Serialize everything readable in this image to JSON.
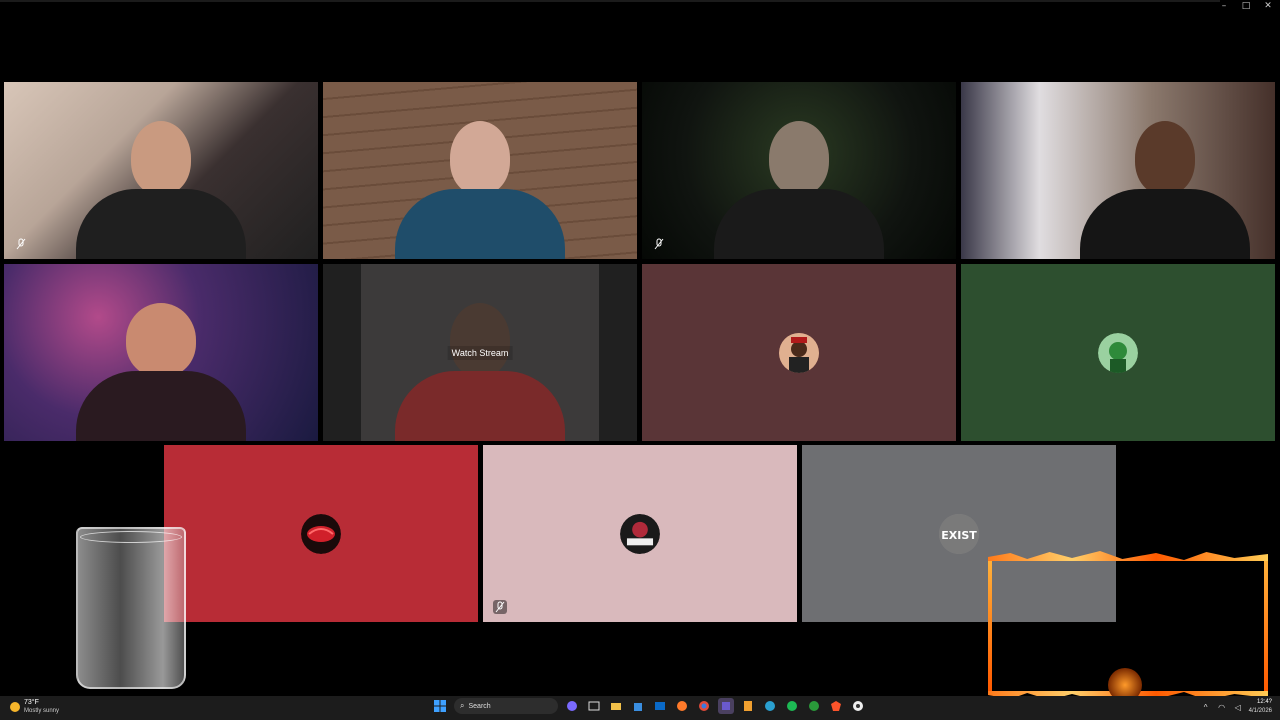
{
  "window": {
    "controls": [
      "–",
      "□",
      "✕"
    ]
  },
  "tiles": [
    {
      "id": "cam1",
      "kind": "camera",
      "muted": true
    },
    {
      "id": "cam2",
      "kind": "camera",
      "muted": false
    },
    {
      "id": "cam3",
      "kind": "camera",
      "muted": true
    },
    {
      "id": "cam4",
      "kind": "camera",
      "muted": false
    },
    {
      "id": "cam5",
      "kind": "camera",
      "muted": false,
      "speaking": true
    },
    {
      "id": "stream",
      "kind": "stream",
      "label": "Watch Stream"
    },
    {
      "id": "avatar1",
      "kind": "avatar",
      "bg": "#5a3537"
    },
    {
      "id": "avatar2",
      "kind": "avatar",
      "bg": "#2d4f2f"
    },
    {
      "id": "avatar3",
      "kind": "avatar",
      "bg": "#b82c36",
      "muted": false
    },
    {
      "id": "avatar4",
      "kind": "avatar",
      "bg": "#d9b9bc",
      "muted": true
    },
    {
      "id": "avatar5",
      "kind": "avatar",
      "bg": "#6e6f72",
      "avatar_text": "EXIST"
    }
  ],
  "colors": {
    "speaking_border": "#5fb85f",
    "taskbar": "#1c1c1c"
  },
  "taskbar": {
    "weather": {
      "temp": "73°F",
      "condition": "Mostly sunny",
      "icon": "sun-icon"
    },
    "search": {
      "label": "Search",
      "icon": "search-icon"
    },
    "apps": [
      "start-icon",
      "search",
      "copilot-icon",
      "task-view-icon",
      "file-explorer-icon",
      "store-icon",
      "outlook-icon",
      "firefox-icon",
      "chrome-icon",
      "teams-icon",
      "files-icon",
      "edge-icon",
      "spotify-icon",
      "xbox-icon",
      "brave-icon",
      "obs-icon"
    ],
    "clock": {
      "time": "12:4?",
      "date": "4/1/2026"
    }
  }
}
